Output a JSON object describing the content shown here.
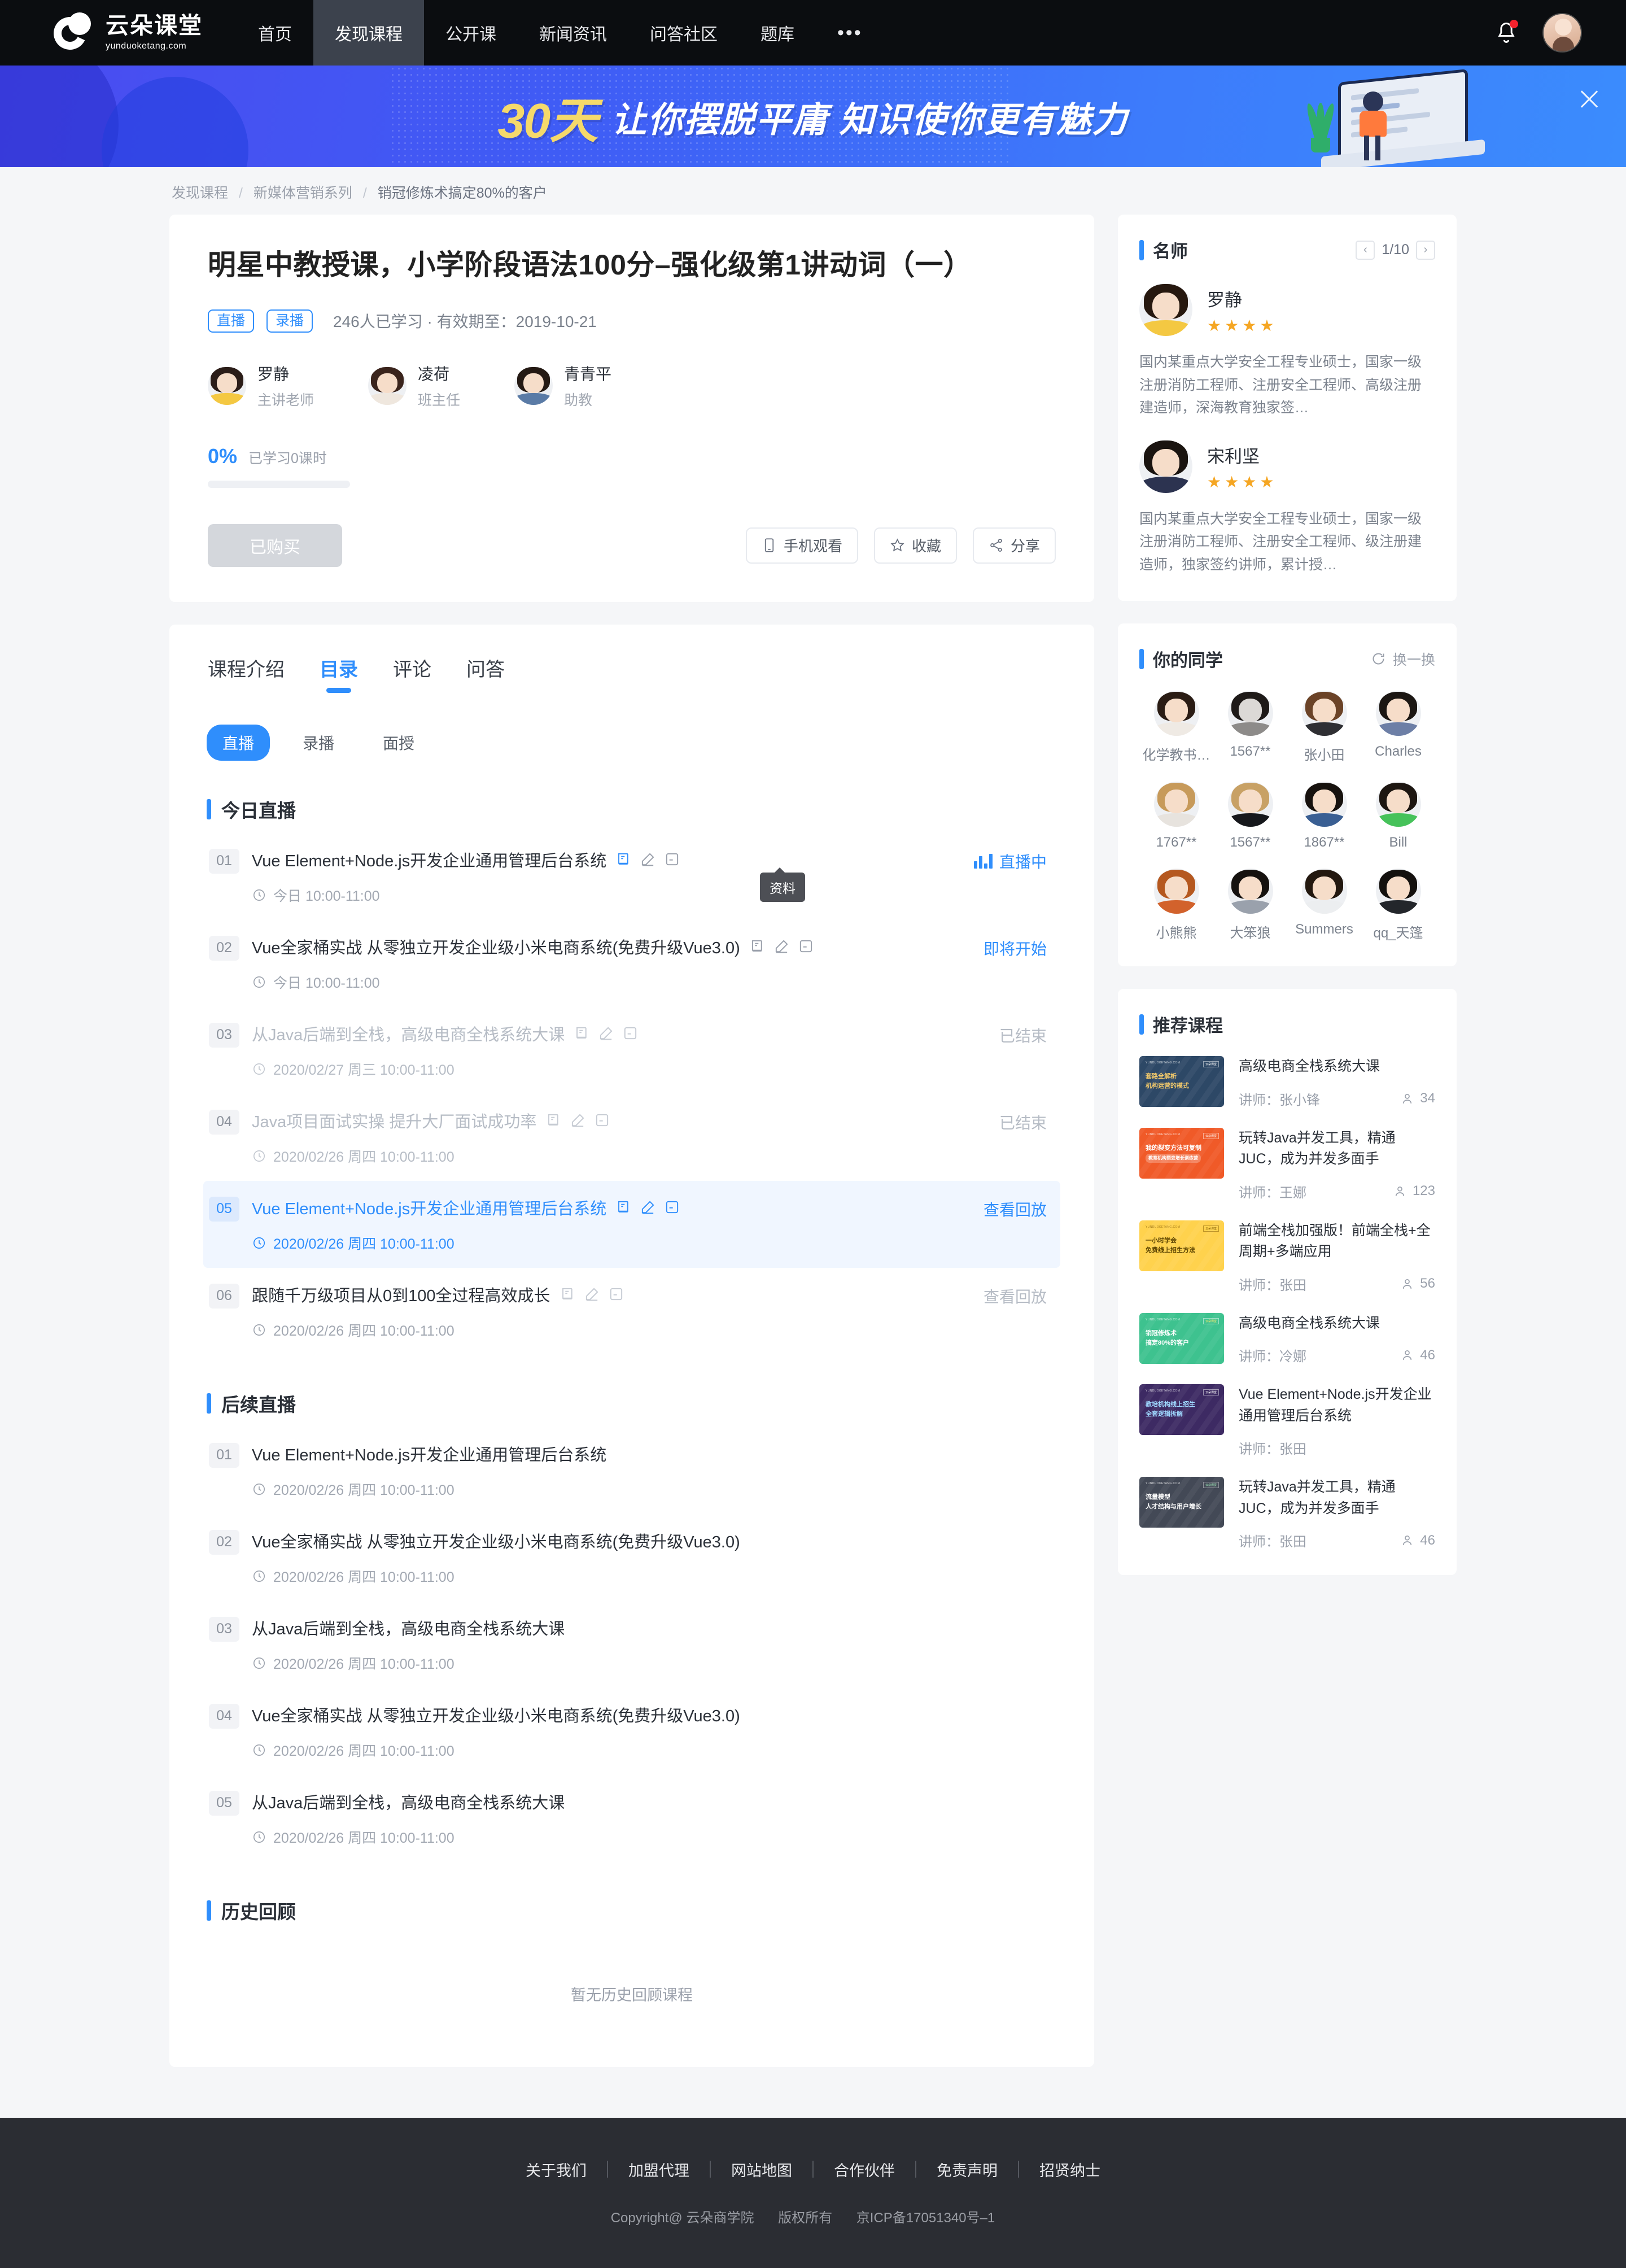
{
  "nav": {
    "logo_main": "云朵课堂",
    "logo_sub": "yunduoketang.com",
    "items": [
      "首页",
      "发现课程",
      "公开课",
      "新闻资讯",
      "问答社区",
      "题库"
    ],
    "more": "•••",
    "active_index": 1
  },
  "banner": {
    "highlight": "30天",
    "headline": "让你摆脱平庸  知识使你更有魅力"
  },
  "breadcrumb": {
    "items": [
      "发现课程",
      "新媒体营销系列",
      "销冠修炼术搞定80%的客户"
    ]
  },
  "course": {
    "title": "明星中教授课，小学阶段语法100分–强化级第1讲动词（一）",
    "tags": [
      "直播",
      "录播"
    ],
    "meta": "246人已学习 · 有效期至：2019-10-21",
    "teachers": [
      {
        "name": "罗静",
        "role": "主讲老师"
      },
      {
        "name": "凌荷",
        "role": "班主任"
      },
      {
        "name": "青青平",
        "role": "助教"
      }
    ],
    "progress_pct": "0%",
    "progress_label": "已学习0课时",
    "buy_label": "已购买",
    "actions": [
      {
        "label": "手机观看",
        "icon": "phone-icon"
      },
      {
        "label": "收藏",
        "icon": "star-icon"
      },
      {
        "label": "分享",
        "icon": "share-icon"
      }
    ]
  },
  "tabs": {
    "items": [
      "课程介绍",
      "目录",
      "评论",
      "问答"
    ],
    "active_index": 1,
    "subtabs": [
      "直播",
      "录播",
      "面授"
    ],
    "subtab_active_index": 0
  },
  "tooltip": "资料",
  "sections": {
    "today": {
      "title": "今日直播",
      "lessons": [
        {
          "num": "01",
          "title": "Vue Element+Node.js开发企业通用管理后台系统",
          "time": "今日 10:00-11:00",
          "status": "直播中",
          "status_type": "live",
          "icons": [
            "book-icon",
            "pencil-icon",
            "note-icon"
          ],
          "state": "normal"
        },
        {
          "num": "02",
          "title": "Vue全家桶实战 从零独立开发企业级小米电商系统(免费升级Vue3.0)",
          "time": "今日 10:00-11:00",
          "status": "即将开始",
          "status_type": "soon",
          "icons": [
            "book-icon",
            "pencil-icon",
            "note-icon"
          ],
          "state": "normal"
        },
        {
          "num": "03",
          "title": "从Java后端到全栈，高级电商全栈系统大课",
          "time": "2020/02/27 周三 10:00-11:00",
          "status": "已结束",
          "status_type": "ended",
          "icons": [
            "book-icon",
            "pencil-icon",
            "note-icon"
          ],
          "state": "ended"
        },
        {
          "num": "04",
          "title": "Java项目面试实操 提升大厂面试成功率",
          "time": "2020/02/26 周四 10:00-11:00",
          "status": "已结束",
          "status_type": "ended",
          "icons": [
            "book-icon",
            "pencil-icon",
            "note-icon"
          ],
          "state": "ended"
        },
        {
          "num": "05",
          "title": "Vue Element+Node.js开发企业通用管理后台系统",
          "time": "2020/02/26 周四 10:00-11:00",
          "status": "查看回放",
          "status_type": "replay",
          "icons": [
            "book-icon",
            "pencil-icon",
            "note-icon"
          ],
          "state": "selected"
        },
        {
          "num": "06",
          "title": "跟随千万级项目从0到100全过程高效成长",
          "time": "2020/02/26 周四 10:00-11:00",
          "status": "查看回放",
          "status_type": "replay-dim",
          "icons": [
            "book-icon",
            "pencil-icon",
            "note-icon"
          ],
          "state": "normal"
        }
      ]
    },
    "upcoming": {
      "title": "后续直播",
      "lessons": [
        {
          "num": "01",
          "title": "Vue Element+Node.js开发企业通用管理后台系统",
          "time": "2020/02/26 周四 10:00-11:00"
        },
        {
          "num": "02",
          "title": "Vue全家桶实战 从零独立开发企业级小米电商系统(免费升级Vue3.0)",
          "time": "2020/02/26 周四 10:00-11:00"
        },
        {
          "num": "03",
          "title": "从Java后端到全栈，高级电商全栈系统大课",
          "time": "2020/02/26 周四 10:00-11:00"
        },
        {
          "num": "04",
          "title": "Vue全家桶实战 从零独立开发企业级小米电商系统(免费升级Vue3.0)",
          "time": "2020/02/26 周四 10:00-11:00"
        },
        {
          "num": "05",
          "title": "从Java后端到全栈，高级电商全栈系统大课",
          "time": "2020/02/26 周四 10:00-11:00"
        }
      ]
    },
    "history": {
      "title": "历史回顾",
      "empty_text": "暂无历史回顾课程"
    }
  },
  "sidebar": {
    "teachers_panel": {
      "title": "名师",
      "page": "1/10",
      "prev": "‹",
      "next": "›",
      "teachers": [
        {
          "name": "罗静",
          "stars": 4,
          "desc": "国内某重点大学安全工程专业硕士，国家一级注册消防工程师、注册安全工程师、高级注册建造师，深海教育独家签…"
        },
        {
          "name": "宋利坚",
          "stars": 4,
          "desc": "国内某重点大学安全工程专业硕士，国家一级注册消防工程师、注册安全工程师、级注册建造师，独家签约讲师，累计授…"
        }
      ]
    },
    "mates_panel": {
      "title": "你的同学",
      "refresh_label": "换一换",
      "mates": [
        "化学教书…",
        "1567**",
        "张小田",
        "Charles",
        "1767**",
        "1567**",
        "1867**",
        "Bill",
        "小熊熊",
        "大笨狼",
        "Summers",
        "qq_天篷"
      ]
    },
    "rec_panel": {
      "title": "推荐课程",
      "teacher_prefix": "讲师：",
      "courses": [
        {
          "title": "高级电商全栈系统大课",
          "teacher": "张小锋",
          "count": "34",
          "thumb_color": "#2d4866",
          "thumb_l1": "套路全解析",
          "thumb_l2": "机构运营的模式",
          "thumb_brand": "YUNDUOKETANG.COM",
          "thumb_corner": "云朵课堂"
        },
        {
          "title": "玩转Java并发工具，精通JUC，成为并发多面手",
          "teacher": "王娜",
          "count": "123",
          "thumb_color": "#f05a28",
          "thumb_l1": "我的裂变方法可复制",
          "thumb_l2": "教育机构裂变增长训练营",
          "thumb_brand": "YUNDUOKETANG.COM",
          "thumb_corner": "云朵课堂"
        },
        {
          "title": "前端全栈加强版！前端全栈+全周期+多端应用",
          "teacher": "张田",
          "count": "56",
          "thumb_color": "#ffd24d",
          "thumb_l1": "一小时学会",
          "thumb_l2": "免费线上招生方法",
          "thumb_brand": "YUNDUOKETANG.COM",
          "thumb_corner": "云朵课堂"
        },
        {
          "title": "高级电商全栈系统大课",
          "teacher": "冷娜",
          "count": "46",
          "thumb_color": "#3ec28f",
          "thumb_l1": "销冠修炼术",
          "thumb_l2": "搞定80%的客户",
          "thumb_brand": "YUNDUOKETANG.COM",
          "thumb_corner": "云朵课堂"
        },
        {
          "title": "Vue Element+Node.js开发企业通用管理后台系统",
          "teacher": "张田",
          "count": "",
          "thumb_color": "#3d2a63",
          "thumb_l1": "教培机构线上招生",
          "thumb_l2": "全套逻辑拆解",
          "thumb_brand": "YUNDUOKETANG.COM",
          "thumb_corner": "云朵课堂"
        },
        {
          "title": "玩转Java并发工具，精通JUC，成为并发多面手",
          "teacher": "张田",
          "count": "46",
          "thumb_color": "#434956",
          "thumb_l1": "流量模型",
          "thumb_l2": "人才结构与用户增长",
          "thumb_brand": "YUNDUOKETANG.COM",
          "thumb_corner": "云朵课堂"
        }
      ]
    }
  },
  "footer": {
    "links": [
      "关于我们",
      "加盟代理",
      "网站地图",
      "合作伙伴",
      "免责声明",
      "招贤纳士"
    ],
    "copyright": "Copyright@ 云朵商学院",
    "rights": "版权所有",
    "icp": "京ICP备17051340号–1"
  }
}
